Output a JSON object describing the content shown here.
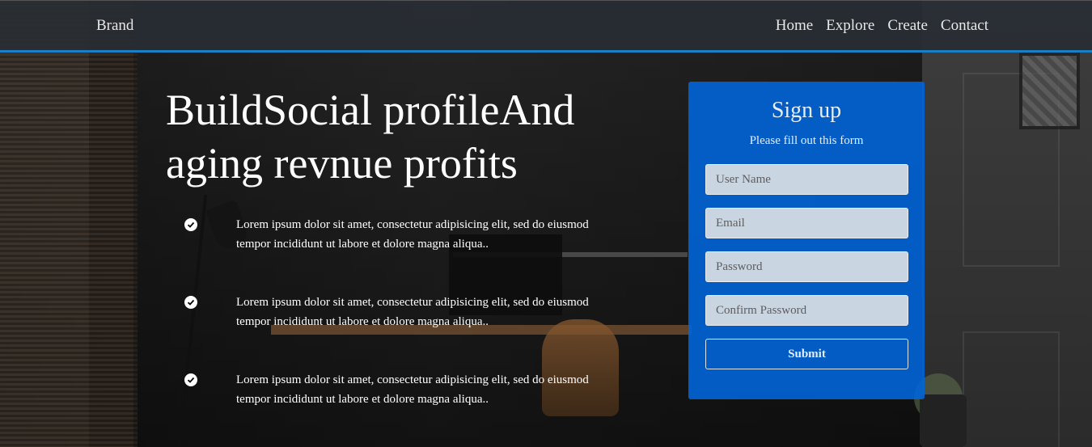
{
  "navbar": {
    "brand": "Brand",
    "links": [
      "Home",
      "Explore",
      "Create",
      "Contact"
    ]
  },
  "hero": {
    "title": "BuildSocial profileAnd aging revnue profits",
    "features": [
      "Lorem ipsum dolor sit amet, consectetur adipisicing elit, sed do eiusmod tempor incididunt ut labore et dolore magna aliqua..",
      "Lorem ipsum dolor sit amet, consectetur adipisicing elit, sed do eiusmod tempor incididunt ut labore et dolore magna aliqua..",
      "Lorem ipsum dolor sit amet, consectetur adipisicing elit, sed do eiusmod tempor incididunt ut labore et dolore magna aliqua.."
    ]
  },
  "signup": {
    "title": "Sign up",
    "subtitle": "Please fill out this form",
    "fields": {
      "username_placeholder": "User Name",
      "email_placeholder": "Email",
      "password_placeholder": "Password",
      "confirm_placeholder": "Confirm Password"
    },
    "submit_label": "Submit"
  },
  "colors": {
    "navbar_border": "#1a7fc4",
    "card_bg": "#0066dc"
  },
  "icons": {
    "feature_icon": "check-circle-icon"
  }
}
